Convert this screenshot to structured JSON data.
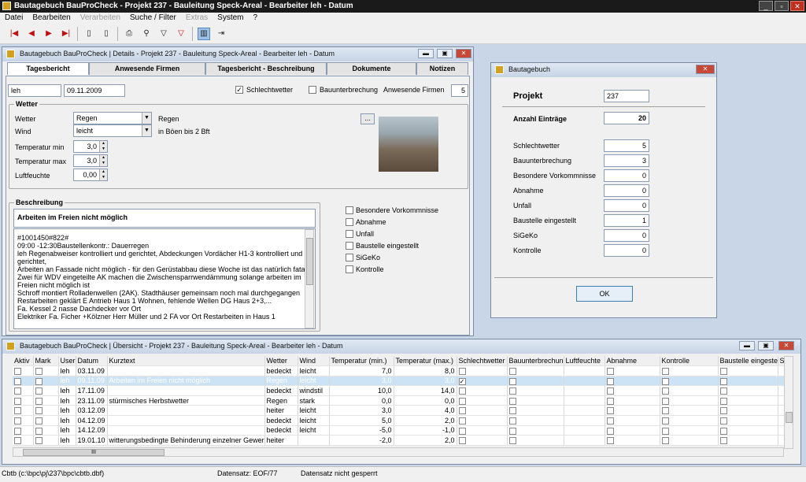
{
  "app": {
    "title": "Bautagebuch BauProCheck - Projekt 237 - Bauleitung Speck-Areal - Bearbeiter leh - Datum"
  },
  "menu": [
    "Datei",
    "Bearbeiten",
    "Verarbeiten",
    "Suche / Filter",
    "Extras",
    "System",
    "?"
  ],
  "details": {
    "title": "Bautagebuch BauProCheck | Details - Projekt 237 - Bauleitung Speck-Areal - Bearbeiter leh - Datum",
    "tabs": [
      "Tagesbericht",
      "Anwesende Firmen",
      "Tagesbericht - Beschreibung",
      "Dokumente",
      "Notizen"
    ],
    "user": "leh",
    "date": "09.11.2009",
    "schlechtwetter_label": "Schlechtwetter",
    "bauunterbrechung_label": "Bauunterbrechung",
    "anwesende_label": "Anwesende Firmen",
    "anwesende_value": "5",
    "wetter_group": "Wetter",
    "wetter_label": "Wetter",
    "wetter_value": "Regen",
    "wetter_text": "Regen",
    "wind_label": "Wind",
    "wind_value": "leicht",
    "wind_text": "in Böen bis 2 Bft",
    "tmin_label": "Temperatur min",
    "tmin_value": "3,0",
    "tmax_label": "Temperatur max",
    "tmax_value": "3,0",
    "luft_label": "Luftfeuchte",
    "luft_value": "0,00",
    "browse_label": "...",
    "beschreibung_group": "Beschreibung",
    "beschreibung_title": "Arbeiten im Freien nicht möglich",
    "beschreibung_lines": [
      "#1001450#822#",
      "09:00 -12:30Baustellenkontr.: Dauerregen",
      "leh Regenabweiser kontrolliert und gerichtet, Abdeckungen Vordächer H1-3 kontrolliert und",
      "gerichtet,",
      "Arbeiten an Fassade nicht möglich - für den Gerüstabbau diese Woche ist das natürlich  fatal",
      "Zwei für WDV eingeteilte AK machen die Zwischensparrwendämmung solange arbeiten im",
      "Freien nicht möglich ist",
      "Schroff montiert Rolladenwellen (2AK). Stadthäuser gemeinsam noch mal durchgegangen",
      "Restarbeiten geklärt E Antrieb Haus 1 Wohnen, fehlende Wellen DG Haus 2+3,...",
      "Fa. Kessel 2 nasse Dachdecker vor Ort",
      "Elektriker Fa. Ficher +Kölzner Herr Müller und 2 FA vor Ort Restarbeiten in Haus 1"
    ],
    "checks": [
      "Besondere Vorkommnisse",
      "Abnahme",
      "Unfall",
      "Baustelle eingestellt",
      "SiGeKo",
      "Kontrolle"
    ]
  },
  "dialog": {
    "title": "Bautagebuch",
    "projekt_label": "Projekt",
    "projekt_value": "237",
    "anzahl_label": "Anzahl Einträge",
    "anzahl_value": "20",
    "rows": [
      {
        "label": "Schlechtwetter",
        "value": "5"
      },
      {
        "label": "Bauunterbrechung",
        "value": "3"
      },
      {
        "label": "Besondere Vorkommnisse",
        "value": "0"
      },
      {
        "label": "Abnahme",
        "value": "0"
      },
      {
        "label": "Unfall",
        "value": "0"
      },
      {
        "label": "Baustelle eingestellt",
        "value": "1"
      },
      {
        "label": "SiGeKo",
        "value": "0"
      },
      {
        "label": "Kontrolle",
        "value": "0"
      }
    ],
    "ok_label": "OK"
  },
  "overview": {
    "title": "Bautagebuch BauProCheck | Übersicht - Projekt 237 - Bauleitung Speck-Areal - Bearbeiter leh - Datum",
    "columns": [
      "Aktiv",
      "Mark",
      "User",
      "Datum",
      "Kurztext",
      "Wetter",
      "Wind",
      "Temperatur (min.)",
      "Temperatur (max.)",
      "Schlechtwetter",
      "Bauunterbrechung",
      "Luftfeuchte",
      "Abnahme",
      "Kontrolle",
      "Baustelle eingestellt",
      "Si"
    ],
    "rows": [
      {
        "user": "leh",
        "datum": "03.11.09",
        "kurztext": "",
        "wetter": "bedeckt",
        "wind": "leicht",
        "tmin": "7,0",
        "tmax": "8,0",
        "schlecht": false,
        "sel": false
      },
      {
        "user": "leh",
        "datum": "09.11.09",
        "kurztext": "Arbeiten im Freien nicht möglich",
        "wetter": "Regen",
        "wind": "leicht",
        "tmin": "3,0",
        "tmax": "3,0",
        "schlecht": true,
        "sel": true
      },
      {
        "user": "leh",
        "datum": "17.11.09",
        "kurztext": "",
        "wetter": "bedeckt",
        "wind": "windstil",
        "tmin": "10,0",
        "tmax": "14,0",
        "schlecht": false,
        "sel": false
      },
      {
        "user": "leh",
        "datum": "23.11.09",
        "kurztext": "stürmisches Herbstwetter",
        "wetter": "Regen",
        "wind": "stark",
        "tmin": "0,0",
        "tmax": "0,0",
        "schlecht": false,
        "sel": false
      },
      {
        "user": "leh",
        "datum": "03.12.09",
        "kurztext": "",
        "wetter": "heiter",
        "wind": "leicht",
        "tmin": "3,0",
        "tmax": "4,0",
        "schlecht": false,
        "sel": false
      },
      {
        "user": "leh",
        "datum": "04.12.09",
        "kurztext": "",
        "wetter": "bedeckt",
        "wind": "leicht",
        "tmin": "5,0",
        "tmax": "2,0",
        "schlecht": false,
        "sel": false
      },
      {
        "user": "leh",
        "datum": "14.12.09",
        "kurztext": "",
        "wetter": "bedeckt",
        "wind": "leicht",
        "tmin": "-5,0",
        "tmax": "-1,0",
        "schlecht": false,
        "sel": false
      },
      {
        "user": "leh",
        "datum": "19.01.10",
        "kurztext": "witterungsbedingte Behinderung einzelner Gewerke",
        "wetter": "heiter",
        "wind": "",
        "tmin": "-2,0",
        "tmax": "2,0",
        "schlecht": false,
        "sel": false
      }
    ],
    "hscroll_label": "III"
  },
  "status": {
    "left": "Cbtb (c:\\bpc\\pj\\237\\bpc\\cbtb.dbf)",
    "middle": "Datensatz: EOF/77",
    "right": "Datensatz nicht gesperrt"
  }
}
